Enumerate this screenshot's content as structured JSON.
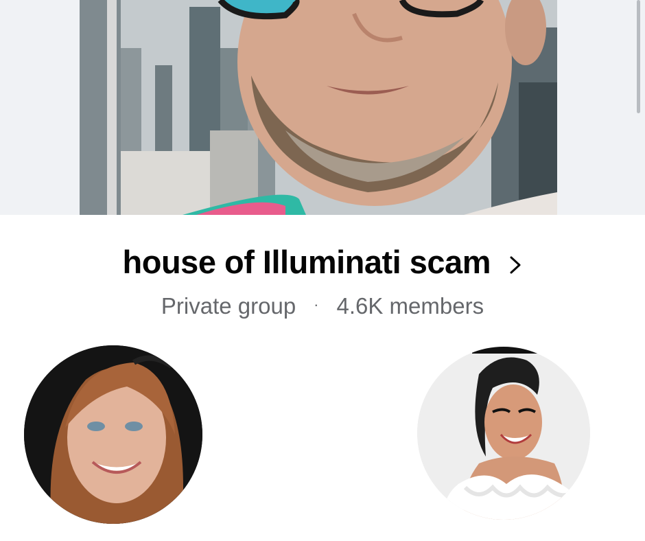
{
  "group": {
    "name": "house of Illuminati scam",
    "privacy": "Private group",
    "separator": "·",
    "member_count": "4.6K members"
  },
  "cover": {
    "icon": "cover-photo",
    "description_hidden": true
  },
  "members_preview": {
    "left_avatar_icon": "member-avatar",
    "right_avatar_icon": "member-avatar"
  },
  "colors": {
    "title": "#050505",
    "meta": "#65676b",
    "cover_band": "#f0f2f5",
    "background": "#ffffff"
  }
}
